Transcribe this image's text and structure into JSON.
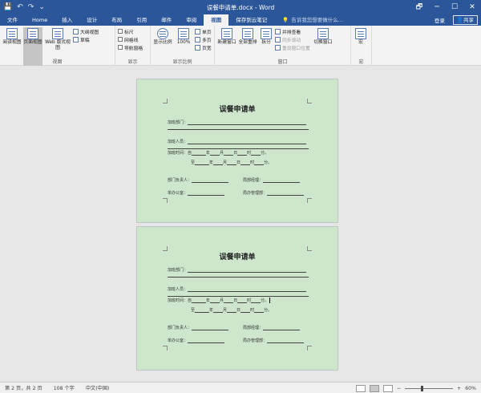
{
  "titlebar": {
    "title": "误餐申请单.docx - Word",
    "qat": {
      "save": "💾",
      "undo": "↶",
      "redo": "↷",
      "more": "⌄"
    },
    "controls": {
      "restore": "🗗",
      "minimize": "─",
      "maximize": "☐",
      "close": "✕"
    }
  },
  "tabs": [
    "文件",
    "Home",
    "插入",
    "设计",
    "布局",
    "引用",
    "邮件",
    "审阅",
    "视图",
    "保存到云笔记"
  ],
  "active_tab": "视图",
  "tell_me": "告诉我您想要做什么...",
  "account": {
    "login": "登录",
    "share": "共享"
  },
  "ribbon": {
    "views": {
      "label": "视图",
      "read": "阅读视图",
      "print": "页面视图",
      "web": "Web 版式视图",
      "outline": "大纲视图",
      "draft": "草稿"
    },
    "show": {
      "label": "显示",
      "ruler": "标尺",
      "grid": "网格线",
      "nav": "导航窗格"
    },
    "zoom": {
      "label": "显示比例",
      "zoom": "显示比例",
      "pct": "100%",
      "one": "单页",
      "multi": "多页",
      "width": "页宽"
    },
    "window": {
      "label": "窗口",
      "new": "新建窗口",
      "arrange": "全部重排",
      "split": "拆分",
      "side": "并排查看",
      "sync": "同步滚动",
      "reset": "重设窗口位置",
      "switch": "切换窗口"
    },
    "macro": {
      "label": "宏",
      "btn": "宏"
    }
  },
  "doc": {
    "title": "误餐申请单",
    "dept": "加班部门：",
    "staff": "加班人员：",
    "time": "加班时间：",
    "from": "自",
    "to": "至",
    "year": "年",
    "month": "月",
    "day": "日",
    "hour": "时",
    "minute": "分。",
    "dept_head": "部门负责人：",
    "office": "单办公室：",
    "finance": "局部经理：",
    "manager": "局办管理部："
  },
  "status": {
    "page": "第 2 页，共 2 页",
    "words": "108 个字",
    "lang": "中文(中国)",
    "zoom": "60%"
  }
}
